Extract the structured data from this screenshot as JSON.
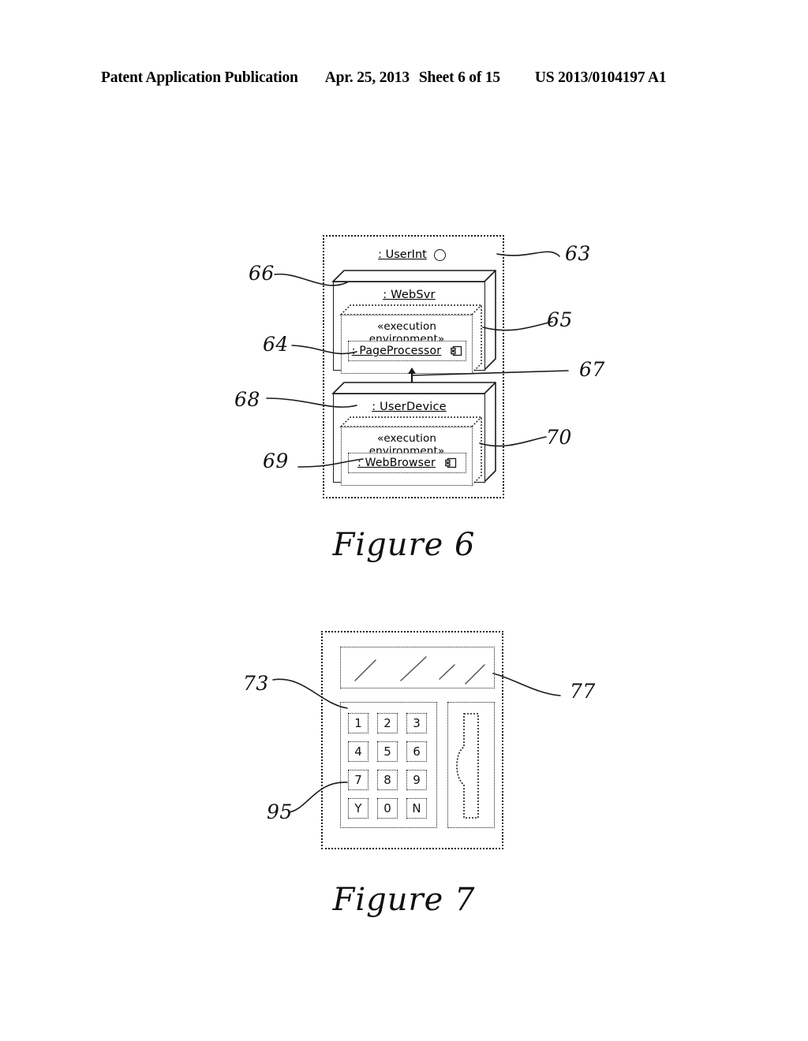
{
  "header": {
    "publication": "Patent Application Publication",
    "date": "Apr. 25, 2013",
    "sheet": "Sheet 6 of 15",
    "patent_number": "US 2013/0104197 A1"
  },
  "figure6": {
    "caption": "Figure 6",
    "interface": {
      "label": ": UserInt",
      "icon": "lollipop-circle-icon"
    },
    "nodes": [
      {
        "id": "websvr",
        "label": ": WebSvr",
        "env_label": "«execution environment»",
        "component_label": ": PageProcessor",
        "component_icon": "uml-component-icon"
      },
      {
        "id": "userdevice",
        "label": ": UserDevice",
        "env_label": "«execution environment»",
        "component_label": ": WebBrowser",
        "component_icon": "uml-component-icon"
      }
    ],
    "connector": {
      "name": "bidirectional-arrow",
      "icon": "double-headed-arrow-icon"
    },
    "reference_numerals": [
      {
        "id": "n63",
        "text": "63",
        "side": "right",
        "target": "outer-system-boundary"
      },
      {
        "id": "n66",
        "text": "66",
        "side": "left",
        "target": "websvr-node"
      },
      {
        "id": "n65",
        "text": "65",
        "side": "right",
        "target": "websvr-execution-environment"
      },
      {
        "id": "n64",
        "text": "64",
        "side": "left",
        "target": "page-processor-component"
      },
      {
        "id": "n67",
        "text": "67",
        "side": "right",
        "target": "communication-link"
      },
      {
        "id": "n68",
        "text": "68",
        "side": "left",
        "target": "userdevice-node"
      },
      {
        "id": "n70",
        "text": "70",
        "side": "right",
        "target": "userdevice-execution-environment"
      },
      {
        "id": "n69",
        "text": "69",
        "side": "left",
        "target": "web-browser-component"
      }
    ]
  },
  "figure7": {
    "caption": "Figure 7",
    "device": {
      "screen_name": "display-screen",
      "screen_lines": 4,
      "keypad_rows": [
        [
          "1",
          "2",
          "3"
        ],
        [
          "4",
          "5",
          "6"
        ],
        [
          "7",
          "8",
          "9"
        ],
        [
          "Y",
          "0",
          "N"
        ]
      ],
      "card_slot_name": "card-slot"
    },
    "reference_numerals": [
      {
        "id": "n73",
        "text": "73",
        "side": "left",
        "target": "keypad-panel"
      },
      {
        "id": "n95",
        "text": "95",
        "side": "left",
        "target": "key-7"
      },
      {
        "id": "n77",
        "text": "77",
        "side": "right",
        "target": "display-screen"
      }
    ]
  },
  "colors": {
    "ink": "#1a1a1a",
    "paper": "#ffffff"
  }
}
